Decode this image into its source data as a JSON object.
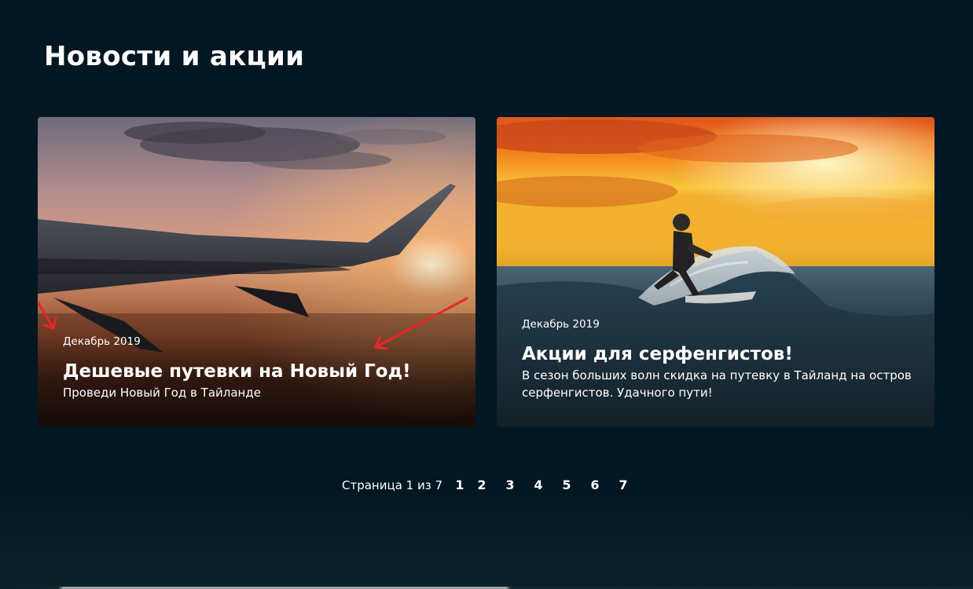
{
  "page": {
    "title": "Новости и акции"
  },
  "cards": [
    {
      "date": "Декабрь 2019",
      "title": "Дешевые путевки на Новый Год!",
      "description": "Проведи Новый Год в Тайланде",
      "image": "airplane-wing-sunset"
    },
    {
      "date": "Декабрь 2019",
      "title": "Акции для серфенгистов!",
      "description": "В сезон больших волн скидка на путевку в Тайланд на остров серфенгистов. Удачного пути!",
      "image": "surfer-wave-sunset"
    }
  ],
  "pagination": {
    "info": "Страница 1 из 7",
    "pages": [
      "1",
      "2",
      "3",
      "4",
      "5",
      "6",
      "7"
    ],
    "current": "1"
  },
  "colors": {
    "background": "#021722",
    "text": "#ffffff",
    "annotation_arrow": "#e8262b"
  }
}
